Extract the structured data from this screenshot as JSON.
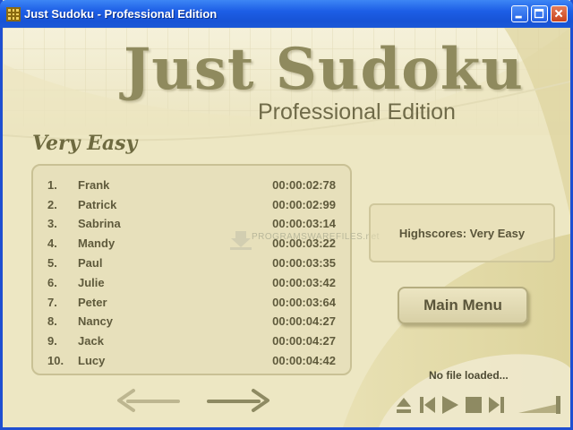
{
  "window": {
    "title": "Just Sudoku - Professional Edition"
  },
  "logo": {
    "main": "Just Sudoku",
    "sub": "Professional Edition"
  },
  "difficulty_label": "Very Easy",
  "highscores": [
    {
      "rank": "1.",
      "name": "Frank",
      "time": "00:00:02:78"
    },
    {
      "rank": "2.",
      "name": "Patrick",
      "time": "00:00:02:99"
    },
    {
      "rank": "3.",
      "name": "Sabrina",
      "time": "00:00:03:14"
    },
    {
      "rank": "4.",
      "name": "Mandy",
      "time": "00:00:03:22"
    },
    {
      "rank": "5.",
      "name": "Paul",
      "time": "00:00:03:35"
    },
    {
      "rank": "6.",
      "name": "Julie",
      "time": "00:00:03:42"
    },
    {
      "rank": "7.",
      "name": "Peter",
      "time": "00:00:03:64"
    },
    {
      "rank": "8.",
      "name": "Nancy",
      "time": "00:00:04:27"
    },
    {
      "rank": "9.",
      "name": "Jack",
      "time": "00:00:04:27"
    },
    {
      "rank": "10.",
      "name": "Lucy",
      "time": "00:00:04:42"
    }
  ],
  "highscore_box": {
    "label": "Highscores: Very Easy"
  },
  "main_menu": {
    "label": "Main Menu"
  },
  "player": {
    "status": "No file loaded..."
  },
  "watermark": {
    "text": "PROGRAMSWAREFILES.net"
  },
  "colors": {
    "title_bar": "#1d5ee6",
    "background": "#f0ebcb",
    "accent_olive": "#8f8a5e",
    "text_dark": "#5a553a"
  }
}
